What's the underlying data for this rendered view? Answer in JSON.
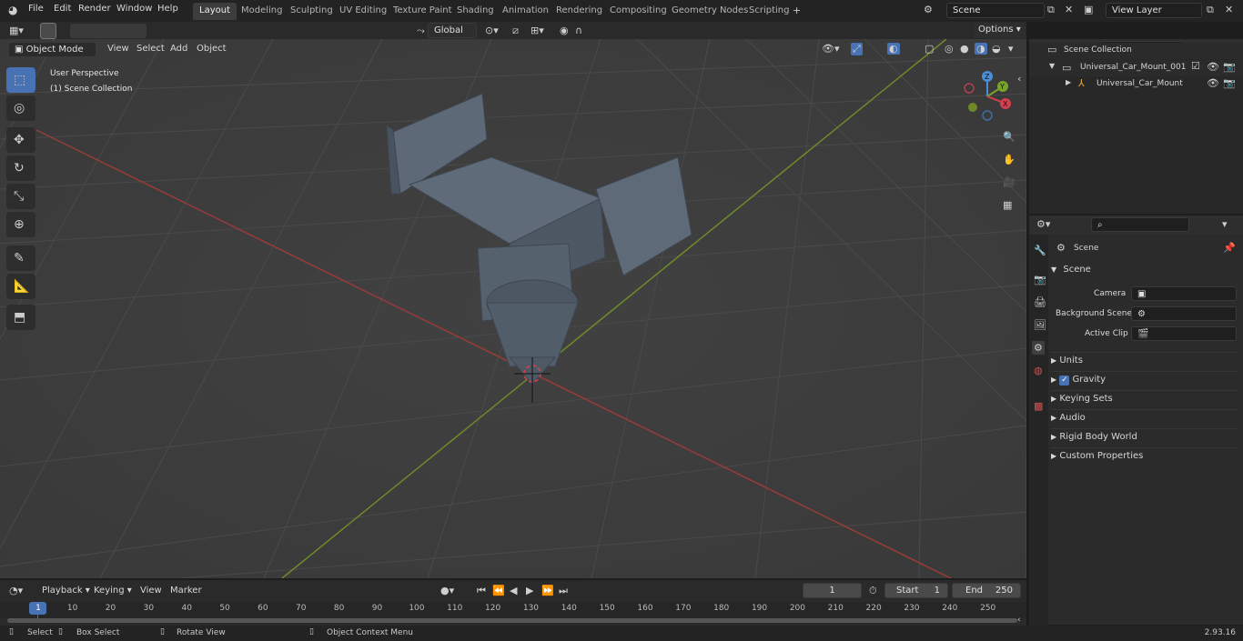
{
  "app": {
    "version": "2.93.16"
  },
  "menu": [
    "File",
    "Edit",
    "Render",
    "Window",
    "Help"
  ],
  "workspaces": [
    "Layout",
    "Modeling",
    "Sculpting",
    "UV Editing",
    "Texture Paint",
    "Shading",
    "Animation",
    "Rendering",
    "Compositing",
    "Geometry Nodes",
    "Scripting"
  ],
  "scene_field": "Scene",
  "view_layer_field": "View Layer",
  "header": {
    "transform_orientation": "Global",
    "options_label": "Options"
  },
  "viewport_header": {
    "mode": "Object Mode",
    "menus": [
      "View",
      "Select",
      "Add",
      "Object"
    ]
  },
  "viewport": {
    "perspective": "User Perspective",
    "collection": "(1) Scene Collection"
  },
  "gizmo": {
    "x": "X",
    "y": "Y",
    "z": "Z"
  },
  "outliner": {
    "root": "Scene Collection",
    "items": [
      {
        "label": "Universal_Car_Mount_001"
      },
      {
        "label": "Universal_Car_Mount"
      }
    ]
  },
  "properties": {
    "context": "Scene",
    "panel": "Scene",
    "fields": [
      {
        "label": "Camera"
      },
      {
        "label": "Background Scene"
      },
      {
        "label": "Active Clip"
      }
    ],
    "sections": [
      "Units",
      "Gravity",
      "Keying Sets",
      "Audio",
      "Rigid Body World",
      "Custom Properties"
    ]
  },
  "timeline": {
    "menus": [
      "Playback",
      "Keying",
      "View",
      "Marker"
    ],
    "current_frame": "1",
    "start_label": "Start",
    "start": "1",
    "end_label": "End",
    "end": "250",
    "ticks": [
      "1",
      "10",
      "20",
      "30",
      "40",
      "50",
      "60",
      "70",
      "80",
      "90",
      "100",
      "110",
      "120",
      "130",
      "140",
      "150",
      "160",
      "170",
      "180",
      "190",
      "200",
      "210",
      "220",
      "230",
      "240",
      "250"
    ]
  },
  "status": {
    "select": "Select",
    "box_select": "Box Select",
    "rotate_view": "Rotate View",
    "context_menu": "Object Context Menu"
  }
}
